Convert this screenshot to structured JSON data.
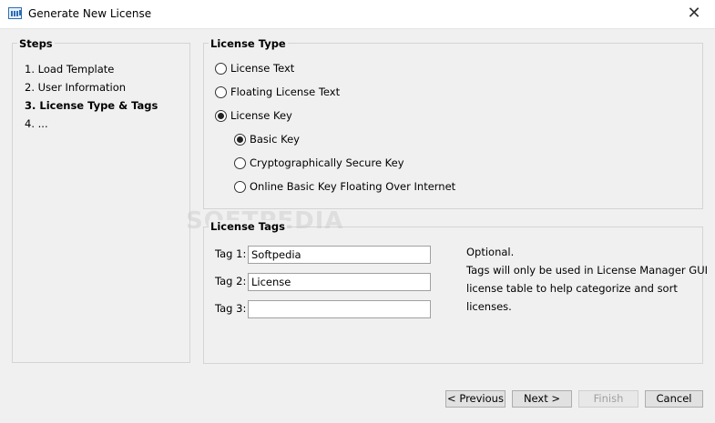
{
  "window": {
    "title": "Generate New License",
    "close_glyph": "✕"
  },
  "steps": {
    "title": "Steps",
    "items": [
      "1. Load Template",
      "2. User Information",
      "3. License Type & Tags",
      "4. ..."
    ]
  },
  "license_type": {
    "title": "License Type",
    "options": [
      "License Text",
      "Floating License Text",
      "License Key"
    ],
    "selected": "License Key",
    "sub_options": [
      "Basic Key",
      "Cryptographically Secure Key",
      "Online Basic Key Floating Over Internet"
    ],
    "sub_selected": "Basic Key"
  },
  "license_tags": {
    "title": "License Tags",
    "tag1_label": "Tag 1:",
    "tag1_value": "Softpedia",
    "tag2_label": "Tag 2:",
    "tag2_value": "License",
    "tag3_label": "Tag 3:",
    "tag3_value": "",
    "help_line1": "Optional.",
    "help_line2": "Tags will only be used in License Manager GUI",
    "help_line3": "license table to help categorize and sort licenses."
  },
  "buttons": {
    "previous": "< Previous",
    "next": "Next >",
    "finish": "Finish",
    "cancel": "Cancel"
  },
  "watermark": "SOFTPEDIA",
  "colors": {
    "window_bg": "#f0f0f0",
    "titlebar_bg": "#ffffff",
    "border": "#d4d4d4"
  }
}
